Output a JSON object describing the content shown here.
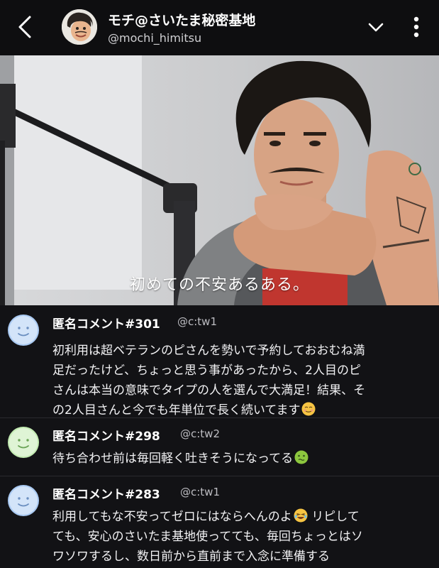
{
  "header": {
    "channel_name": "モチ@さいたま秘密基地",
    "handle": "@mochi_himitsu"
  },
  "video": {
    "subtitle": "初めての不安あるある。"
  },
  "comments": [
    {
      "name": "匿名コメント#301",
      "handle": "@c:tw1",
      "avatar_color": "#a9c9f2",
      "line1": "初利用は超ベテランのピさんを勢いで予約しておおむね満",
      "line2": "足だったけど、ちょっと思う事があったから、2人目のピ",
      "line3": "さんは本当の意味でタイプの人を選んで大満足！結果、そ",
      "line4": "の2人目さんと今でも年単位で長く続いてます",
      "emoji_icon": "relieved-face-icon"
    },
    {
      "name": "匿名コメント#298",
      "handle": "@c:tw2",
      "avatar_color": "#c3ebb2",
      "line1": "待ち合わせ前は毎回軽く吐きそうになってる",
      "emoji_icon": "nauseated-face-icon"
    },
    {
      "name": "匿名コメント#283",
      "handle": "@c:tw1",
      "avatar_color": "#a9c9f2",
      "line1a": "利用してもな不安ってゼロにはならへんのよ",
      "line1b": " リピして",
      "line2": "ても、安心のさいたま基地使ってても、毎回ちょっとはソ",
      "line3": "ワソワするし、数日前から直前まで入念に準備する",
      "emoji_icon": "joy-face-icon"
    }
  ]
}
